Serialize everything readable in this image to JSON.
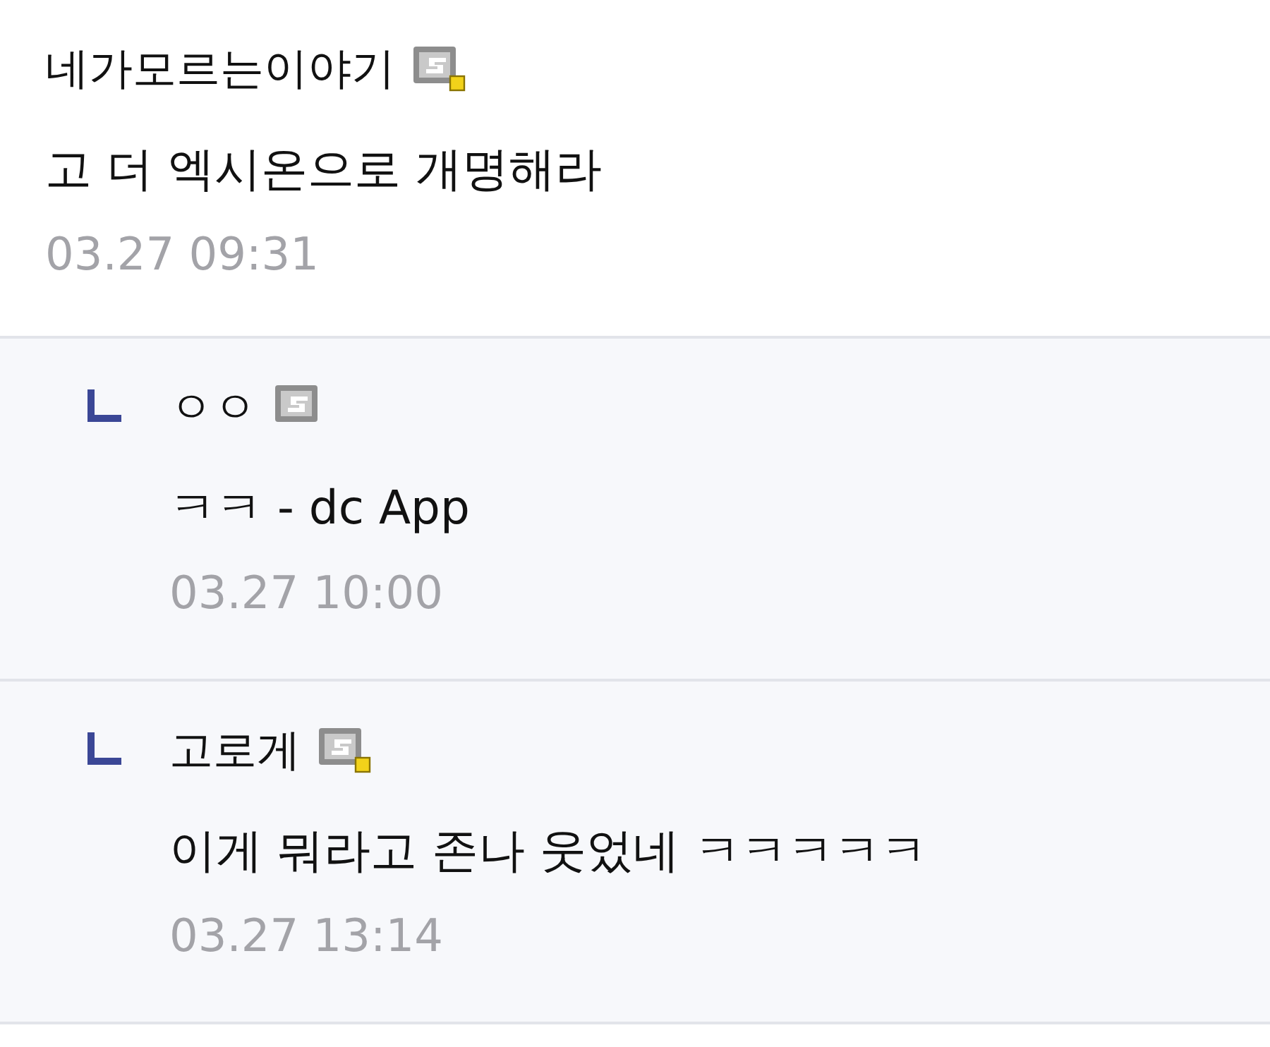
{
  "comment": {
    "author": "네가모르는이야기",
    "badge_dot": true,
    "text": "고 더 엑시온으로 개명해라",
    "time": "03.27 09:31"
  },
  "replies": [
    {
      "author": "ㅇㅇ",
      "badge_dot": false,
      "text": "ㅋㅋ - dc App",
      "time": "03.27 10:00"
    },
    {
      "author": "고로게",
      "badge_dot": true,
      "text": "이게 뭐라고 존나 웃었네 ㅋㅋㅋㅋㅋ",
      "time": "03.27 13:14"
    }
  ]
}
